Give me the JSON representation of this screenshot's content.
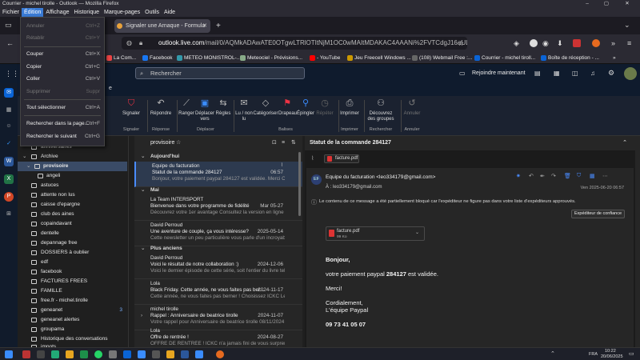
{
  "window": {
    "title": "Courrier - michel tirolle - Outlook — Mozilla Firefox",
    "controls": [
      "–",
      "▢",
      "✕"
    ]
  },
  "menubar": [
    "Fichier",
    "Édition",
    "Affichage",
    "Historique",
    "Marque-pages",
    "Outils",
    "Aide"
  ],
  "tabs": [
    {
      "label": "Signaler une Arnaque - Formula"
    },
    {
      "label": "+"
    }
  ],
  "url": {
    "host": "outlook.live.com",
    "rest": "/mail/0/AQMkADAwATE0OTgwLTRlOTItNjM1OC0wMAItMDAKAC4AAANi%2FVTCdgJ16aULoVDoV%2"
  },
  "bookmarks": [
    {
      "label": "La Com...",
      "color": "#e44"
    },
    {
      "label": "Facebook",
      "color": "#1877f2"
    },
    {
      "label": "METEO MONISTROL-...",
      "color": "#39a"
    },
    {
      "label": "Meteociel - Prévisions...",
      "color": "#8a8"
    },
    {
      "label": "- YouTube",
      "color": "#f00"
    },
    {
      "label": "Jeu Freecell Windows ...",
      "color": "#c90"
    },
    {
      "label": "(108) Webmail Free :...",
      "color": "#666"
    },
    {
      "label": "Courrier - michel tiroll...",
      "color": "#0a64d6"
    },
    {
      "label": "Boîte de réception - ...",
      "color": "#0a64d6"
    }
  ],
  "outlook": {
    "search_placeholder": "Rechercher",
    "meet_now": "Rejoindre maintenant"
  },
  "ribbon": {
    "tab_fragment": "e",
    "buttons": [
      {
        "label": "Signaler",
        "icon": "shield"
      },
      {
        "label": "Répondre",
        "icon": "reply"
      },
      {
        "label": "Ranger",
        "icon": "broom"
      },
      {
        "label": "Déplacer vers",
        "icon": "folder-move"
      },
      {
        "label": "Règles",
        "icon": "rules"
      },
      {
        "label": "Lu / non lu",
        "icon": "envelope"
      },
      {
        "label": "Catégoriser",
        "icon": "tag"
      },
      {
        "label": "Drapeau",
        "icon": "flag"
      },
      {
        "label": "Épingler",
        "icon": "pin"
      },
      {
        "label": "Répéter",
        "icon": "clock"
      },
      {
        "label": "Imprimer",
        "icon": "printer"
      },
      {
        "label": "Découvrez des groupes",
        "icon": "groups"
      },
      {
        "label": "Annuler",
        "icon": "undo"
      }
    ],
    "groups": [
      "Signaler",
      "Réponse",
      "Déplacer",
      "Balises",
      "Imprimer",
      "Rechercher",
      "Annuler"
    ]
  },
  "edit_menu": {
    "items": [
      {
        "label": "Annuler",
        "shortcut": "Ctrl+Z",
        "disabled": true
      },
      {
        "label": "Rétablir",
        "shortcut": "Ctrl+Y",
        "disabled": true
      },
      {
        "label": "Couper",
        "shortcut": "Ctrl+X",
        "disabled": false
      },
      {
        "label": "Copier",
        "shortcut": "Ctrl+C",
        "disabled": false
      },
      {
        "label": "Coller",
        "shortcut": "Ctrl+V",
        "disabled": false
      },
      {
        "label": "Supprimer",
        "shortcut": "Suppr",
        "disabled": true
      },
      {
        "label": "Tout sélectionner",
        "shortcut": "Ctrl+A",
        "disabled": false
      },
      {
        "label": "Rechercher dans la page...",
        "shortcut": "Ctrl+F",
        "disabled": false
      },
      {
        "label": "Rechercher le suivant",
        "shortcut": "Ctrl+G",
        "disabled": false
      }
    ]
  },
  "folders": [
    {
      "label": "anniversaires"
    },
    {
      "label": "Archive"
    },
    {
      "label": "provisoire",
      "selected": true
    },
    {
      "label": "angeli"
    },
    {
      "label": "astuces"
    },
    {
      "label": "attente non lus"
    },
    {
      "label": "caisse d'epargne"
    },
    {
      "label": "club des aines"
    },
    {
      "label": "copaindavant"
    },
    {
      "label": "dentelle"
    },
    {
      "label": "depannage free"
    },
    {
      "label": "DOSSIERS à oublier"
    },
    {
      "label": "edf"
    },
    {
      "label": "facebook"
    },
    {
      "label": "FACTURES FREES"
    },
    {
      "label": "FAMILLE"
    },
    {
      "label": "free.fr - michel.tirolle"
    },
    {
      "label": "geneanet",
      "count": "3"
    },
    {
      "label": "geneanet alertes"
    },
    {
      "label": "groupama"
    },
    {
      "label": "Historique des conversations"
    },
    {
      "label": "impots"
    }
  ],
  "message_list": {
    "folder_title": "provisoire",
    "sections": [
      "Aujourd'hui",
      "Mai",
      "Plus anciens"
    ],
    "messages": [
      {
        "from": "Equipe du facturation",
        "subject": "Statut de la commande 284127",
        "date": "06:57",
        "preview": "Bonjour, votre paiement paypal 284127 est validée. Merci Cor...",
        "selected": true
      },
      {
        "from": "La Team INTERSPORT",
        "subject": "Bienvenue dans votre programme de fidélité",
        "date": "Mar 05-27",
        "preview": "Découvrez votre 1er avantage Consultez la version en ligne SP..."
      },
      {
        "from": "David Perroud",
        "subject": "Une aventure de couple, ça vous intéresse?",
        "date": "2025-05-14",
        "preview": "Cette newsletter un peu particulière vous parle d'un incroyable ..."
      },
      {
        "from": "David Perroud",
        "subject": "Voici le résultat de notre collaboration :)",
        "date": "2024-12-06",
        "preview": "Voici le dernier épisode de cette série, soit l'entier du livre tel qu'envoy..."
      },
      {
        "from": "Lola",
        "subject": "Black Friday. Cette année, ne vous faites pas ber...",
        "date": "2024-11-17",
        "preview": "Cette année, ne vous faites pas berner ! Choisissez ICKC Le Bl..."
      },
      {
        "from": "michel tirolle",
        "subject": "Rappel : Anniversaire de beatrice tirolle",
        "date": "2024-11-07",
        "preview": "Votre rappel pour Anniversaire de beatrice tirolle 08/11/2024 l..."
      },
      {
        "from": "Lola",
        "subject": "Offre de rentrée !",
        "date": "2024-08-27",
        "preview": "OFFRE DE RENTRÉE ! ICKC n'a jamais fini de vous surprendre ! ..."
      }
    ]
  },
  "reader": {
    "title": "Statut de la commande 284127",
    "attachment_top": "facture.pdf",
    "sender": "Equipe du facturation <leo334179@gmail.com>",
    "to": "À : leo334179@gmail.com",
    "date": "Ven 2025-06-20 06:57",
    "avatar_initials": "EF",
    "warning": "Le contenu de ce message a été partiellement bloqué car l'expéditeur ne figure pas dans votre liste d'expéditeurs approuvés.",
    "trust_button": "Expéditeur de confiance",
    "attachment": {
      "name": "facture.pdf",
      "size": "99 Ko"
    },
    "body": {
      "greeting": "Bonjour,",
      "line1_pre": "votre paiement paypal ",
      "line1_num": "284127",
      "line1_post": " est validée.",
      "thanks": "Merci!",
      "closing": "Cordialement,",
      "signature": "L'équipe Paypal",
      "phone": "09 73 41 05 07"
    }
  },
  "taskbar": {
    "lang": "FRA",
    "time": "10:22",
    "date": "20/06/2025"
  }
}
